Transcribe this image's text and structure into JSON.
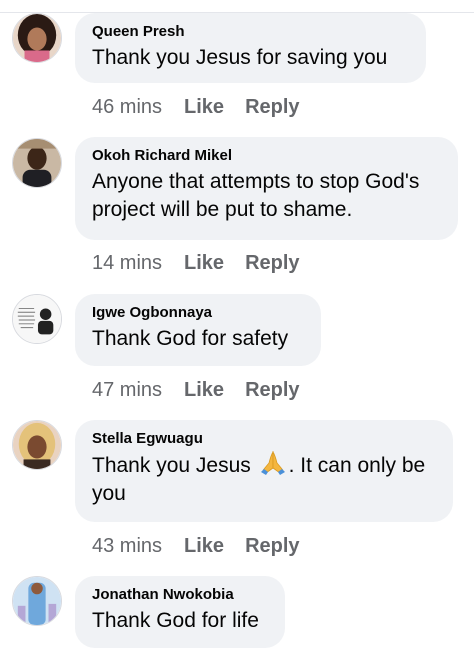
{
  "comments": [
    {
      "author": "Queen Presh",
      "text": "Thank you Jesus for saving you",
      "time": "46 mins",
      "like": "Like",
      "reply": "Reply"
    },
    {
      "author": "Okoh Richard Mikel",
      "text": "Anyone that attempts to stop God's project will be put to shame.",
      "time": "14 mins",
      "like": "Like",
      "reply": "Reply"
    },
    {
      "author": "Igwe Ogbonnaya",
      "text": "Thank God for safety",
      "time": "47 mins",
      "like": "Like",
      "reply": "Reply"
    },
    {
      "author": "Stella Egwuagu",
      "text_before": "Thank you Jesus",
      "emoji": "folded-hands-emoji",
      "text_after": ". It can only be you",
      "time": "43 mins",
      "like": "Like",
      "reply": "Reply"
    },
    {
      "author": "Jonathan Nwokobia",
      "text": "Thank God for life"
    }
  ]
}
